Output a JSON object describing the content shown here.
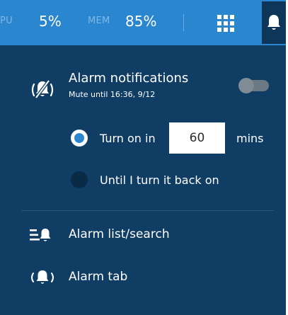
{
  "topbar": {
    "cpu_label": "PU",
    "cpu_value": "5%",
    "mem_label": "MEM",
    "mem_value": "85%",
    "icons": [
      "grid-icon",
      "bell-icon"
    ]
  },
  "alarm_panel": {
    "notifications": {
      "title": "Alarm notifications",
      "mute_text": "Mute until 16:36, 9/12",
      "icon": "bell-muted-icon",
      "toggle_on": false
    },
    "options": {
      "turn_on_in_label": "Turn on in",
      "turn_on_in_value": "60",
      "turn_on_in_unit": "mins",
      "until_label": "Until I turn it back on",
      "selected": "turn_on_in"
    },
    "menu": [
      {
        "label": "Alarm list/search",
        "icon": "alarm-list-icon"
      },
      {
        "label": "Alarm tab",
        "icon": "alarm-ringing-icon"
      }
    ]
  },
  "colors": {
    "topbar": "#2a86cf",
    "panel": "#0f3d63",
    "bell_button": "#0d3658",
    "accent": "#2a86cf"
  }
}
